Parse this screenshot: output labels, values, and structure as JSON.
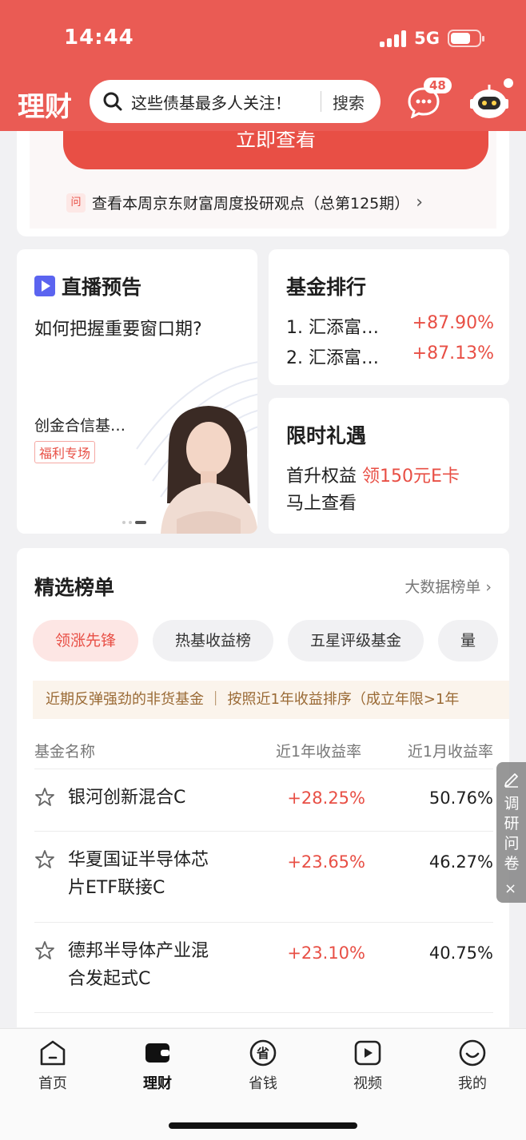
{
  "status": {
    "time": "14:44",
    "network": "5G"
  },
  "header": {
    "brand": "理财",
    "search_placeholder": "这些债基最多人关注！",
    "search_button": "搜索",
    "message_badge": "48"
  },
  "promo": {
    "cta_label": "立即查看",
    "research_tag": "问",
    "research_text": "查看本周京东财富周度投研观点（总第125期）"
  },
  "live": {
    "title": "直播预告",
    "subtitle": "如何把握重要窗口期?",
    "host": "创金合信基…",
    "tag": "福利专场"
  },
  "fund_rank": {
    "title": "基金排行",
    "items": [
      {
        "name": "1. 汇添富…",
        "value": "+87.90%"
      },
      {
        "name": "2. 汇添富…",
        "value": "+87.13%"
      }
    ]
  },
  "gift": {
    "title": "限时礼遇",
    "line1_prefix": "首升权益 ",
    "line1_highlight": "领150元E卡",
    "line2": "马上查看"
  },
  "board": {
    "title": "精选榜单",
    "more": "大数据榜单",
    "chips": [
      "领涨先锋",
      "热基收益榜",
      "五星评级基金",
      "量"
    ],
    "banner": "近期反弹强劲的非货基金  ｜  按照近1年收益排序（成立年限>1年",
    "columns": {
      "name": "基金名称",
      "year": "近1年收益率",
      "month": "近1月收益率"
    },
    "rows": [
      {
        "name_lines": [
          "银河创新混合C"
        ],
        "year": "+28.25%",
        "month": "50.76%"
      },
      {
        "name_lines": [
          "华夏国证半导体芯",
          "片ETF联接C"
        ],
        "year": "+23.65%",
        "month": "46.27%"
      },
      {
        "name_lines": [
          "德邦半导体产业混",
          "合发起式C"
        ],
        "year": "+23.10%",
        "month": "40.75%"
      }
    ]
  },
  "survey": {
    "label": "调研问卷",
    "close": "×"
  },
  "tabbar": {
    "items": [
      {
        "label": "首页",
        "icon": "home-icon"
      },
      {
        "label": "理财",
        "icon": "wallet-icon"
      },
      {
        "label": "省钱",
        "icon": "save-money-icon"
      },
      {
        "label": "视频",
        "icon": "video-icon"
      },
      {
        "label": "我的",
        "icon": "profile-icon"
      }
    ]
  },
  "colors": {
    "brand_red": "#ea5b54",
    "accent_red": "#e84f45",
    "banner_text": "#9a6a35"
  }
}
